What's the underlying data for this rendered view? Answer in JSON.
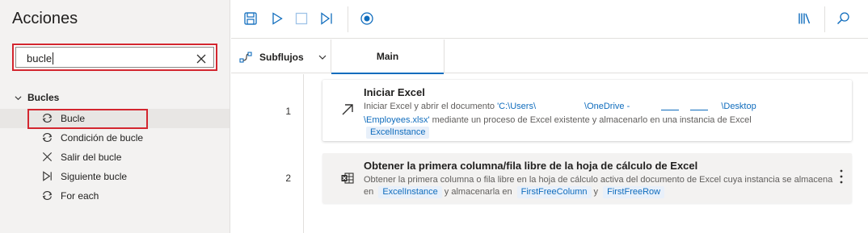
{
  "actions_pane": {
    "title": "Acciones",
    "search": {
      "value": "bucle",
      "placeholder": ""
    },
    "group": {
      "label": "Bucles"
    },
    "items": [
      {
        "label": "Bucle",
        "icon": "loop-icon",
        "selected": true
      },
      {
        "label": "Condición de bucle",
        "icon": "loop-condition-icon",
        "selected": false
      },
      {
        "label": "Salir del bucle",
        "icon": "close-icon",
        "selected": false
      },
      {
        "label": "Siguiente bucle",
        "icon": "next-loop-icon",
        "selected": false
      },
      {
        "label": "For each",
        "icon": "loop-icon",
        "selected": false
      }
    ]
  },
  "toolbar": {
    "icons": [
      "save-icon",
      "run-icon",
      "stop-icon",
      "next-step-icon",
      "breakpoint-icon",
      "variables-icon",
      "search-icon"
    ]
  },
  "tabs": {
    "subflows_label": "Subflujos",
    "main_label": "Main"
  },
  "steps": [
    {
      "line": "1",
      "icon": "launch-excel-icon",
      "title": "Iniciar Excel",
      "desc_prefix": "Iniciar Excel y abrir el documento ",
      "path_part1": "'C:\\Users\\",
      "path_part2": "\\OneDrive - ",
      "path_part3": "\\Desktop",
      "path_part4": "\\Employees.xlsx'",
      "desc_suffix": " mediante un proceso de Excel existente y almacenarlo en una instancia de Excel",
      "var": "ExcelInstance"
    },
    {
      "line": "2",
      "icon": "excel-sheet-icon",
      "title": "Obtener la primera columna/fila libre de la hoja de cálculo de Excel",
      "desc_prefix": "Obtener la primera columna o fila libre en la hoja de cálculo activa del documento de Excel cuya instancia se almacena en",
      "var1": "ExcelInstance",
      "desc_mid": "y almacenarla en",
      "var2": "FirstFreeColumn",
      "desc_and": "y",
      "var3": "FirstFreeRow"
    }
  ],
  "colors": {
    "accent": "#0f6cbd",
    "highlight_box": "#d3262f",
    "pane_bg": "#f3f2f1"
  }
}
